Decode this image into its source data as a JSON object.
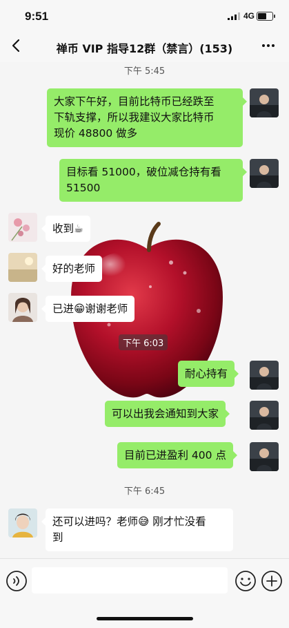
{
  "status_bar": {
    "time": "9:51",
    "network": "4G",
    "battery_level": 0.6
  },
  "nav": {
    "title": "禅币 VIP 指导12群（禁言）(153)",
    "back_icon": "chevron-left-icon",
    "more_icon": "ellipsis-icon"
  },
  "chat": {
    "timestamps": [
      "下午 5:45",
      "下午 6:03",
      "下午 6:45"
    ],
    "messages": [
      {
        "from": "me",
        "text_lines": [
          "大家下午好，目前比特币已经跌至",
          "下轨支撑，所以我建议大家比特币",
          "现价 48800 做多"
        ]
      },
      {
        "from": "me",
        "text_lines": [
          "目标看 51000，破位减仓持有看",
          "51500"
        ]
      },
      {
        "from": "other",
        "text": "收到",
        "emoji": "coffee-icon"
      },
      {
        "from": "other",
        "text": "好的老师"
      },
      {
        "from": "other",
        "text": "已进",
        "emoji": "grin-icon",
        "text_after": "谢谢老师"
      },
      {
        "from": "me",
        "text": "耐心持有"
      },
      {
        "from": "me",
        "text": "可以出我会通知到大家"
      },
      {
        "from": "me",
        "text": "目前已进盈利 400 点"
      },
      {
        "from": "other",
        "text_lines": [
          "还可以进吗？老师",
          "刚才忙没看",
          "到"
        ],
        "emoji": "sweat-smile-icon"
      }
    ]
  },
  "input_bar": {
    "voice_icon": "voice-icon",
    "emoji_icon": "emoji-icon",
    "plus_icon": "plus-icon"
  }
}
